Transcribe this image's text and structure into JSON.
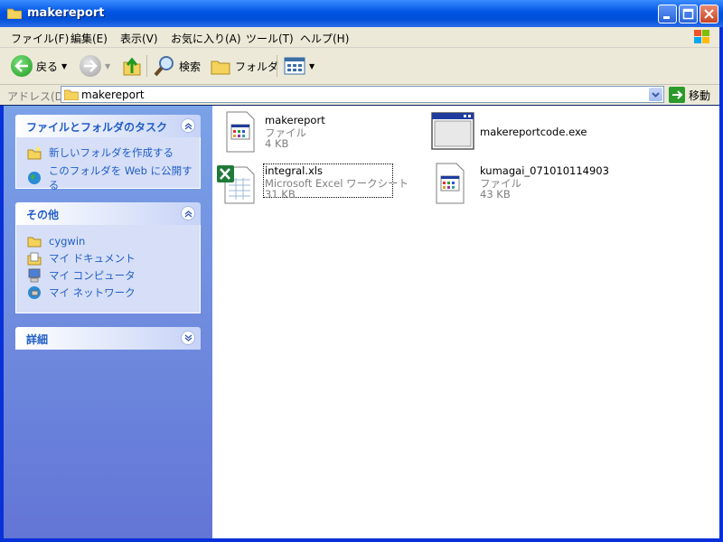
{
  "window": {
    "title": "makereport"
  },
  "menu": [
    "ファイル(F)",
    "編集(E)",
    "表示(V)",
    "お気に入り(A)",
    "ツール(T)",
    "ヘルプ(H)"
  ],
  "toolbar": {
    "back_label": "戻る",
    "search_label": "検索",
    "folders_label": "フォルダ"
  },
  "address": {
    "label": "アドレス(D)",
    "value": "makereport",
    "go_label": "移動"
  },
  "tasks": {
    "title": "ファイルとフォルダのタスク",
    "items": [
      "新しいフォルダを作成する",
      "このフォルダを Web に公開する"
    ]
  },
  "other": {
    "title": "その他",
    "items": [
      "cygwin",
      "マイ ドキュメント",
      "マイ コンピュータ",
      "マイ ネットワーク"
    ]
  },
  "details": {
    "title": "詳細"
  },
  "files": [
    {
      "name": "makereport",
      "type": "ファイル",
      "size": "4 KB"
    },
    {
      "name": "makereportcode.exe"
    },
    {
      "name": "integral.xls",
      "type": "Microsoft Excel ワークシート",
      "size": "31 KB"
    },
    {
      "name": "kumagai_071010114903",
      "type": "ファイル",
      "size": "43 KB"
    }
  ],
  "colors": {
    "titlebar": "#0054e3",
    "taskpane": "#6f8ee0",
    "link": "#215dc6"
  }
}
